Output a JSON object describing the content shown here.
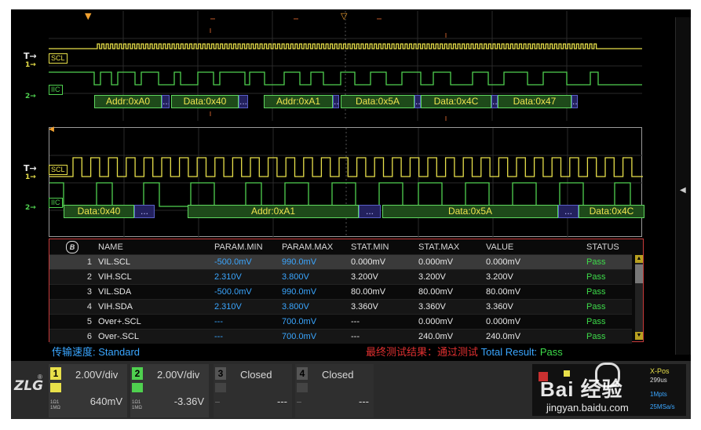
{
  "colors": {
    "ch1": "#e8e04a",
    "ch2": "#4fd04f",
    "limit_blue": "#3aa6ff",
    "pass_green": "#3ddc4a",
    "frame_red": "#c83a3a",
    "result_red": "#e03030"
  },
  "markers": {
    "t_label": "T→",
    "one_label": "1→",
    "two_label": "2→"
  },
  "top_panel": {
    "scl_tag": "SCL",
    "iic_tag": "IIC",
    "decodes": [
      {
        "text": "Addr:0xA0",
        "kind": "addr"
      },
      {
        "text": "Data:0x40",
        "kind": "data"
      },
      {
        "text": "Addr:0xA1",
        "kind": "addr"
      },
      {
        "text": "Data:0x5A",
        "kind": "data"
      },
      {
        "text": "Data:0x4C",
        "kind": "data"
      },
      {
        "text": "Data:0x47",
        "kind": "data"
      }
    ]
  },
  "zoom_panel": {
    "scl_tag": "SCL",
    "iic_tag": "IIC",
    "decodes": [
      {
        "text": "Data:0x40",
        "kind": "data"
      },
      {
        "text": "Addr:0xA1",
        "kind": "addr"
      },
      {
        "text": "Data:0x5A",
        "kind": "data"
      },
      {
        "text": "Data:0x4C",
        "kind": "data"
      }
    ]
  },
  "measurements": {
    "badge": "B",
    "headers": [
      "NAME",
      "PARAM.MIN",
      "PARAM.MAX",
      "STAT.MIN",
      "STAT.MAX",
      "VALUE",
      "STATUS"
    ],
    "rows": [
      {
        "idx": "1",
        "name": "VIL.SCL",
        "pmin": "-500.0mV",
        "pmax": "990.0mV",
        "smin": "0.000mV",
        "smax": "0.000mV",
        "value": "0.000mV",
        "status": "Pass"
      },
      {
        "idx": "2",
        "name": "VIH.SCL",
        "pmin": "2.310V",
        "pmax": "3.800V",
        "smin": "3.200V",
        "smax": "3.200V",
        "value": "3.200V",
        "status": "Pass"
      },
      {
        "idx": "3",
        "name": "VIL.SDA",
        "pmin": "-500.0mV",
        "pmax": "990.0mV",
        "smin": "80.00mV",
        "smax": "80.00mV",
        "value": "80.00mV",
        "status": "Pass"
      },
      {
        "idx": "4",
        "name": "VIH.SDA",
        "pmin": "2.310V",
        "pmax": "3.800V",
        "smin": "3.360V",
        "smax": "3.360V",
        "value": "3.360V",
        "status": "Pass"
      },
      {
        "idx": "5",
        "name": "Over+.SCL",
        "pmin": "---",
        "pmax": "700.0mV",
        "smin": "---",
        "smax": "0.000mV",
        "value": "0.000mV",
        "status": "Pass"
      },
      {
        "idx": "6",
        "name": "Over-.SCL",
        "pmin": "---",
        "pmax": "700.0mV",
        "smin": "---",
        "smax": "240.0mV",
        "value": "240.0mV",
        "status": "Pass"
      }
    ]
  },
  "footer": {
    "speed_label": "传输速度",
    "speed_value": ": Standard",
    "result_cn": "最终测试结果：通过测试",
    "result_label": "Total Result:",
    "result_value": "Pass"
  },
  "channels": [
    {
      "num": "1",
      "scale": "2.00V/div",
      "offset": "640mV",
      "coupling": "1Ω1\n1MΩ"
    },
    {
      "num": "2",
      "scale": "2.00V/div",
      "offset": "-3.36V",
      "coupling": "1Ω1\n1MΩ"
    },
    {
      "num": "3",
      "scale": "Closed",
      "offset": "---",
      "coupling": "---"
    },
    {
      "num": "4",
      "scale": "Closed",
      "offset": "---",
      "coupling": "---"
    }
  ],
  "logo": "ZLG",
  "right_info": {
    "xpos_label": "X-Pos",
    "xpos_value": "299us",
    "mpts": "1Mpts",
    "rate": "25MSa/s"
  },
  "watermark": {
    "text": "Bai 经验",
    "url": "jingyan.baidu.com"
  }
}
